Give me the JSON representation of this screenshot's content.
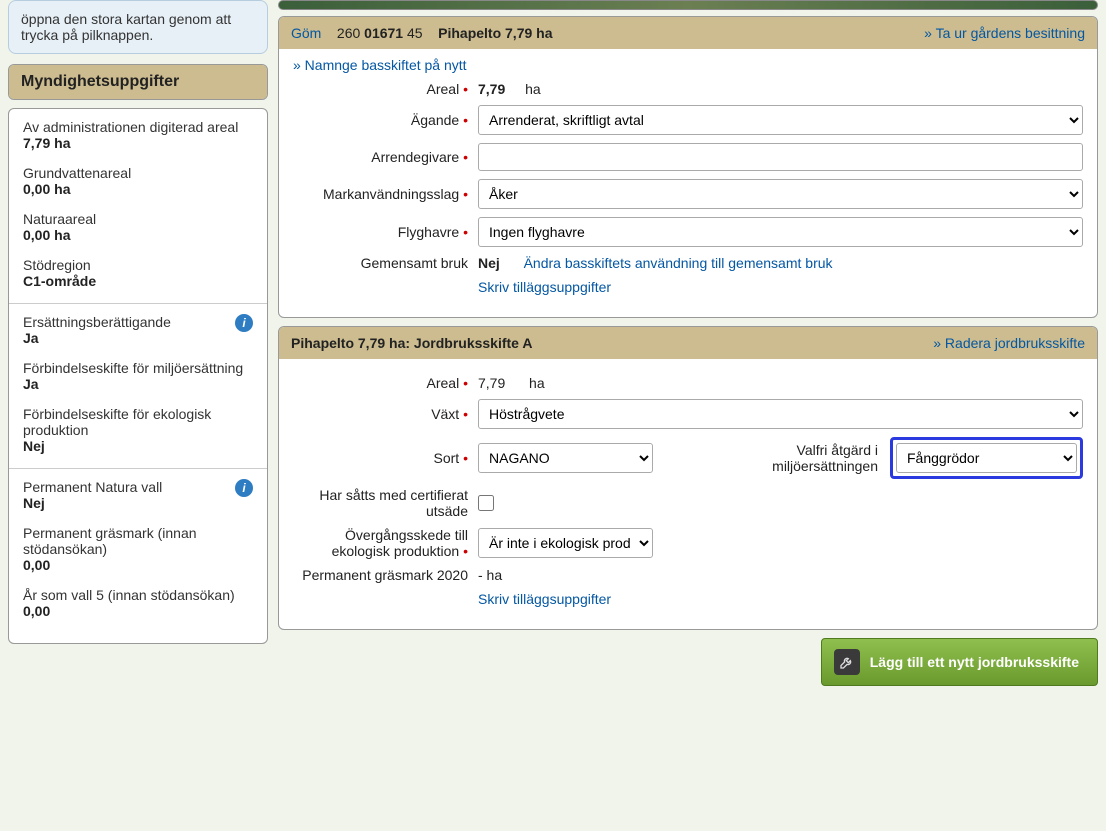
{
  "tip": "öppna den stora kartan genom att trycka på pilknappen.",
  "authPanelTitle": "Myndighetsuppgifter",
  "stats": {
    "digitized_label": "Av administrationen digiterad areal",
    "digitized_value": "7,79 ha",
    "groundwater_label": "Grundvattenareal",
    "groundwater_value": "0,00 ha",
    "natura_label": "Naturaareal",
    "natura_value": "0,00 ha",
    "region_label": "Stödregion",
    "region_value": "C1-område",
    "eligibility_label": "Ersättningsberättigande",
    "eligibility_value": "Ja",
    "env_commit_label": "Förbindelseskifte för miljöersättning",
    "env_commit_value": "Ja",
    "eco_commit_label": "Förbindelseskifte för ekologisk produktion",
    "eco_commit_value": "Nej",
    "perm_natura_label": "Permanent Natura vall",
    "perm_natura_value": "Nej",
    "perm_grass_label": "Permanent gräsmark (innan stödansökan)",
    "perm_grass_value": "0,00",
    "vall5_label": "År som vall 5 (innan stödansökan)",
    "vall5_value": "0,00"
  },
  "parcelHead": {
    "hide": "Göm",
    "id_prefix": "260 ",
    "id_main": "01671",
    "id_suffix": " 45",
    "name": "Pihapelto 7,79 ha",
    "release": "» Ta ur gårdens besittning"
  },
  "parcelLinks": {
    "rename": "» Namnge basskiftet på nytt",
    "changeShared": "Ändra basskiftets användning till gemensamt bruk",
    "extraInfo": "Skriv tilläggsuppgifter"
  },
  "parcelFields": {
    "areal_label": "Areal",
    "areal_value": "7,79",
    "areal_unit": "ha",
    "owner_label": "Ägande",
    "owner_value": "Arrenderat, skriftligt avtal",
    "lessor_label": "Arrendegivare",
    "lessor_value": "",
    "landuse_label": "Markanvändningsslag",
    "landuse_value": "Åker",
    "wildoat_label": "Flyghavre",
    "wildoat_value": "Ingen flyghavre",
    "shared_label": "Gemensamt bruk",
    "shared_value": "Nej"
  },
  "subParcel": {
    "title": "Pihapelto 7,79 ha: Jordbruksskifte A",
    "delete": "» Radera jordbruksskifte",
    "areal_label": "Areal",
    "areal_value": "7,79",
    "areal_unit": "ha",
    "crop_label": "Växt",
    "crop_value": "Höstrågvete",
    "variety_label": "Sort",
    "variety_value": "NAGANO",
    "optional_label1": "Valfri åtgärd i",
    "optional_label2": "miljöersättningen",
    "optional_value": "Fånggrödor",
    "certseed_label1": "Har såtts med certifierat",
    "certseed_label2": "utsäde",
    "ecotrans_label1": "Övergångsskede till",
    "ecotrans_label2": "ekologisk produktion",
    "ecotrans_value": "Är inte i ekologisk produ",
    "permgrass_label": "Permanent gräsmark 2020",
    "permgrass_value": "- ha",
    "extra": "Skriv tilläggsuppgifter"
  },
  "addButton": "Lägg till ett nytt jordbruksskifte"
}
